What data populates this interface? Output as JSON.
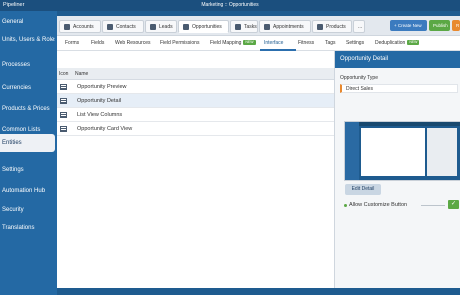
{
  "app": {
    "title": "Pipeliner",
    "context": "Marketing :: Opportunities"
  },
  "sidebar": {
    "items": [
      {
        "label": "General"
      },
      {
        "label": "Units, Users & Roles"
      },
      {
        "label": "Processes"
      },
      {
        "label": "Currencies"
      },
      {
        "label": "Products & Prices"
      },
      {
        "label": "Common Lists"
      },
      {
        "label": "Entities",
        "active": true
      },
      {
        "label": "Settings"
      },
      {
        "label": "Automation Hub"
      },
      {
        "label": "Security"
      },
      {
        "label": "Translations"
      }
    ]
  },
  "entity_tabs": [
    {
      "label": "Accounts",
      "icon": "building-icon"
    },
    {
      "label": "Contacts",
      "icon": "person-icon"
    },
    {
      "label": "Leads",
      "icon": "funnel-icon"
    },
    {
      "label": "Opportunities",
      "icon": "list-icon",
      "active": true
    },
    {
      "label": "Tasks",
      "icon": "checkbox-icon"
    },
    {
      "label": "Appointments",
      "icon": "calendar-icon"
    },
    {
      "label": "Products",
      "icon": "box-icon"
    },
    {
      "label": "..."
    }
  ],
  "buttons": {
    "create_new": "+ Create New",
    "publish": "Publish",
    "extra": "R"
  },
  "sub_tabs": [
    {
      "label": "Forms"
    },
    {
      "label": "Fields"
    },
    {
      "label": "Web Resources"
    },
    {
      "label": "Field Permissions"
    },
    {
      "label": "Field Mapping",
      "badge": "NEW"
    },
    {
      "label": "Interface",
      "active": true
    },
    {
      "label": "Fitness"
    },
    {
      "label": "Tags"
    },
    {
      "label": "Settings"
    },
    {
      "label": "Deduplication",
      "badge": "NEW"
    }
  ],
  "list": {
    "columns": [
      "Icon",
      "Name"
    ],
    "rows": [
      {
        "name": "Opportunity Preview"
      },
      {
        "name": "Opportunity Detail",
        "selected": true
      },
      {
        "name": "List View Columns"
      },
      {
        "name": "Opportunity Card View"
      }
    ]
  },
  "panel": {
    "title": "Opportunity Detail",
    "type_label": "Opportunity Type",
    "type_value": "Direct Sales",
    "edit_button": "Edit Detail",
    "allow_label": "Allow Customize Button",
    "allow_checked": true,
    "collapse_glyph": "<"
  },
  "colors": {
    "brand": "#1e5b8f",
    "accent_green": "#5ba845",
    "accent_orange": "#e8892f",
    "accent_blue": "#3b7bbf"
  }
}
